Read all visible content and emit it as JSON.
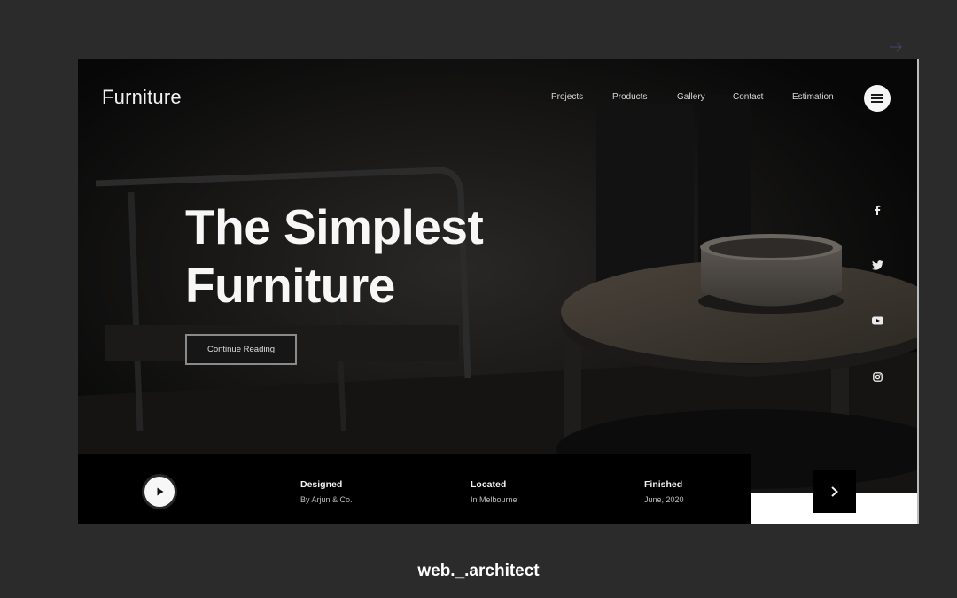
{
  "brand": {
    "logo": "Furniture"
  },
  "nav": {
    "links": [
      "Projects",
      "Products",
      "Gallery",
      "Contact",
      "Estimation"
    ]
  },
  "hero": {
    "headline_line1": "The Simplest",
    "headline_line2": "Furniture",
    "cta_label": "Continue Reading"
  },
  "social": [
    "facebook-icon",
    "twitter-icon",
    "youtube-icon",
    "instagram-icon"
  ],
  "info": [
    {
      "title": "Designed",
      "sub": "By Arjun & Co."
    },
    {
      "title": "Located",
      "sub": "In Melbourne"
    },
    {
      "title": "Finished",
      "sub": "June, 2020"
    }
  ],
  "caption": "web._.architect",
  "colors": {
    "page_background": "#2b2b2b",
    "hero_background": "#0a0a0a",
    "text_primary": "#f7f7f7",
    "info_bar": "#000000"
  }
}
